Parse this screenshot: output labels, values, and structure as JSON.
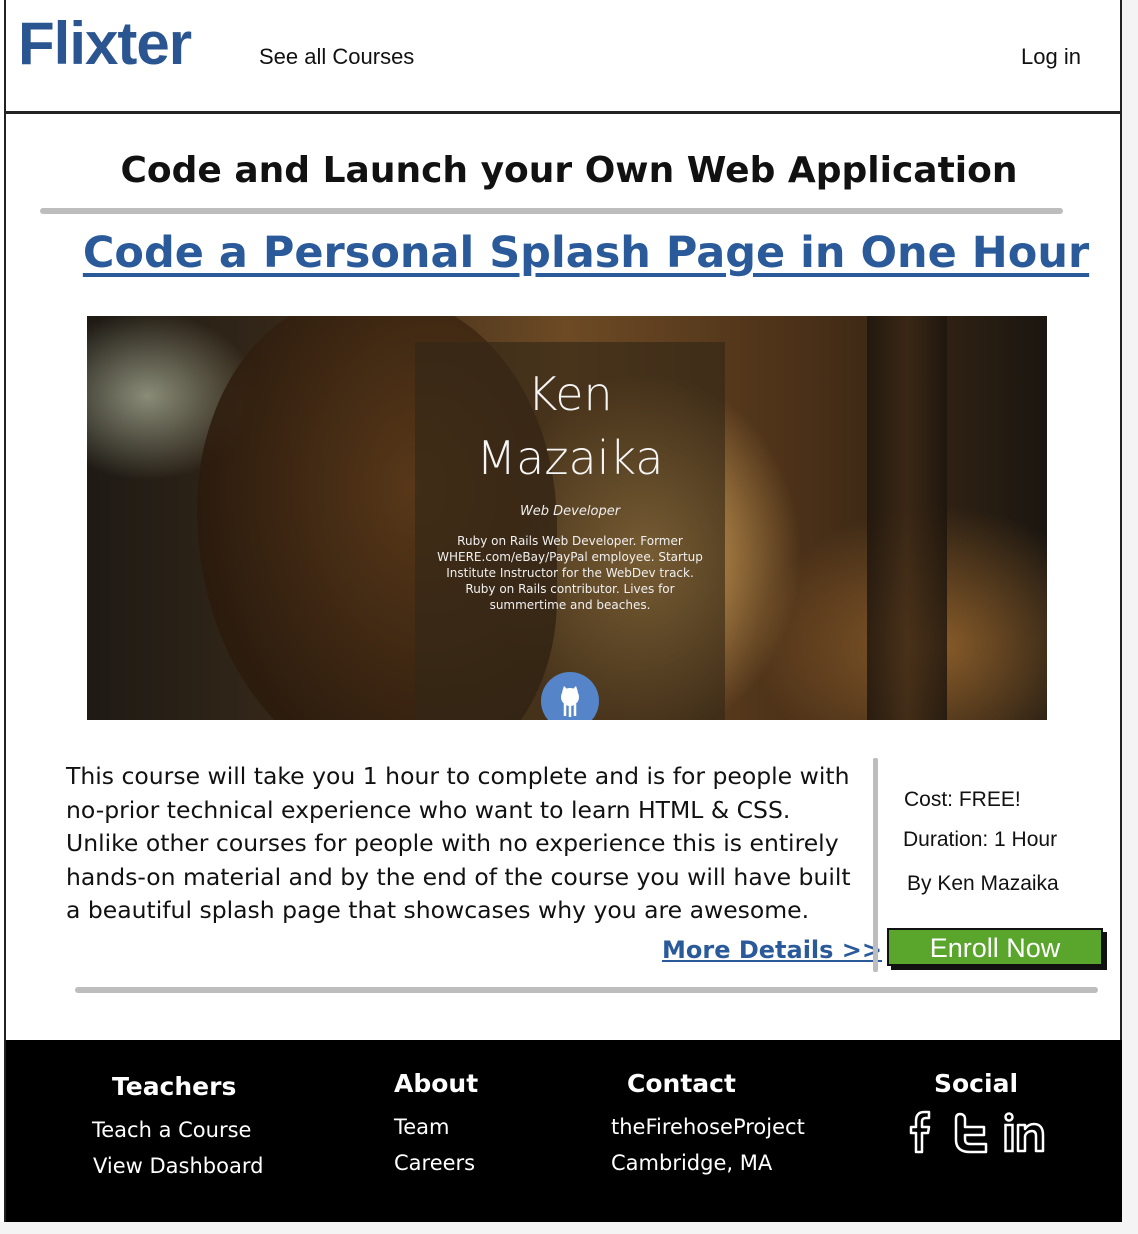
{
  "header": {
    "logo": "Flixter",
    "nav_courses": "See all Courses",
    "nav_login": "Log in"
  },
  "page": {
    "headline": "Code and Launch your Own Web Application",
    "course_title": "Code a Personal Splash Page in One Hour"
  },
  "hero": {
    "name_line1": "Ken",
    "name_line2": "Mazaika",
    "role": "Web Developer",
    "bio": "Ruby on Rails Web Developer. Former WHERE.com/eBay/PayPal employee. Startup Institute Instructor for the WebDev track. Ruby on Rails contributor. Lives for summertime and beaches."
  },
  "course": {
    "description": "This course will take you 1 hour to complete and is for people with no-prior technical experience who want to learn HTML & CSS. Unlike other courses for people with no experience this is entirely hands-on material and by the end of the course you will have built a beautiful splash page that showcases why you are awesome.",
    "more_details": "More Details >>",
    "cost": "Cost: FREE!",
    "duration": "Duration: 1 Hour",
    "author": "By Ken Mazaika",
    "enroll": "Enroll Now"
  },
  "footer": {
    "teachers": {
      "heading": "Teachers",
      "links": [
        "Teach a Course",
        "View Dashboard"
      ]
    },
    "about": {
      "heading": "About",
      "links": [
        "Team",
        "Careers"
      ]
    },
    "contact": {
      "heading": "Contact",
      "links": [
        "theFirehoseProject",
        "Cambridge, MA"
      ]
    },
    "social": {
      "heading": "Social",
      "icons": [
        "facebook-icon",
        "twitter-icon",
        "linkedin-icon"
      ]
    }
  },
  "colors": {
    "brand_blue": "#2a5590",
    "link_blue": "#2a5a99",
    "enroll_green": "#5aa52c",
    "footer_bg": "#000000"
  }
}
